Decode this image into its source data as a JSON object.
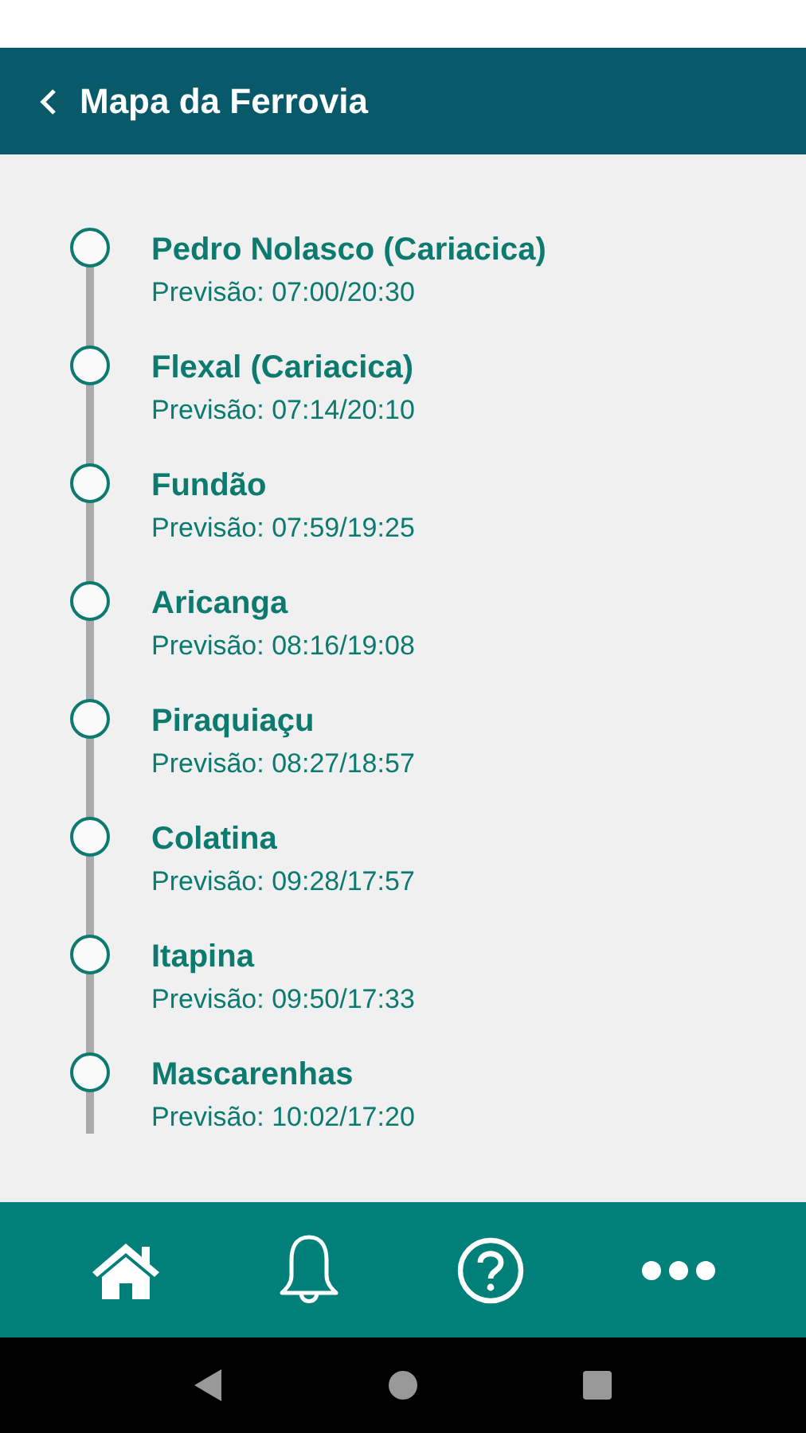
{
  "header": {
    "title": "Mapa da Ferrovia"
  },
  "stations": [
    {
      "name": "Pedro Nolasco (Cariacica)",
      "forecast": "Previsão: 07:00/20:30"
    },
    {
      "name": "Flexal (Cariacica)",
      "forecast": "Previsão: 07:14/20:10"
    },
    {
      "name": "Fundão",
      "forecast": "Previsão: 07:59/19:25"
    },
    {
      "name": "Aricanga",
      "forecast": "Previsão: 08:16/19:08"
    },
    {
      "name": "Piraquiaçu",
      "forecast": "Previsão: 08:27/18:57"
    },
    {
      "name": "Colatina",
      "forecast": "Previsão: 09:28/17:57"
    },
    {
      "name": "Itapina",
      "forecast": "Previsão: 09:50/17:33"
    },
    {
      "name": "Mascarenhas",
      "forecast": "Previsão: 10:02/17:20"
    }
  ]
}
